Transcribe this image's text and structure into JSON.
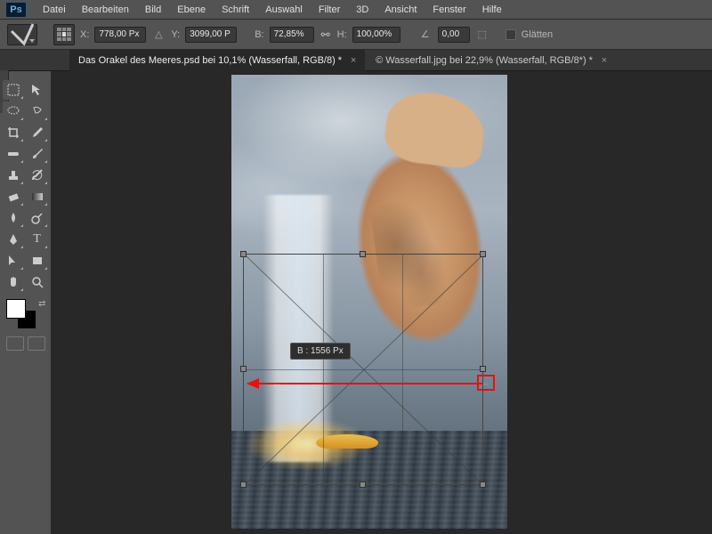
{
  "app": {
    "logo": "Ps"
  },
  "menu": [
    "Datei",
    "Bearbeiten",
    "Bild",
    "Ebene",
    "Schrift",
    "Auswahl",
    "Filter",
    "3D",
    "Ansicht",
    "Fenster",
    "Hilfe"
  ],
  "options": {
    "x_label": "X:",
    "x_value": "778,00 Px",
    "y_label": "Y:",
    "y_value": "3099,00 P",
    "w_label": "B:",
    "w_value": "72,85%",
    "h_label": "H:",
    "h_value": "100,00%",
    "angle_label": "",
    "angle_value": "0,00",
    "smooth_label": "Glätten"
  },
  "tabs": [
    {
      "title": "Das Orakel des Meeres.psd bei 10,1%  (Wasserfall, RGB/8) *",
      "active": true
    },
    {
      "title": "© Wasserfall.jpg bei 22,9% (Wasserfall, RGB/8*) *",
      "active": false
    }
  ],
  "tooltip": {
    "label": "B :",
    "value": "1556 Px"
  },
  "arrow_handle": "↔",
  "swatch": {
    "fg": "#ffffff",
    "bg": "#000000"
  }
}
